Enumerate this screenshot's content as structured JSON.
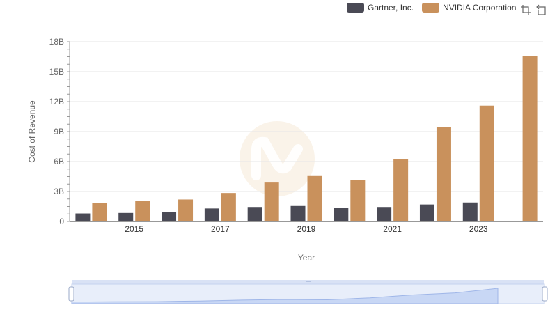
{
  "legend": {
    "items": [
      {
        "label": "Gartner, Inc.",
        "color": "#4a4a55"
      },
      {
        "label": "NVIDIA Corporation",
        "color": "#c9915c"
      }
    ]
  },
  "toolbox": {
    "icons": [
      "zoom-icon",
      "restore-icon"
    ]
  },
  "chart_data": {
    "type": "bar",
    "categories": [
      "2014",
      "2015",
      "2016",
      "2017",
      "2018",
      "2019",
      "2020",
      "2021",
      "2022",
      "2023",
      "2024"
    ],
    "x_tick_labels": [
      "2015",
      "2017",
      "2019",
      "2021",
      "2023"
    ],
    "series": [
      {
        "name": "Gartner, Inc.",
        "color": "#4a4a55",
        "values": [
          0.8,
          0.85,
          0.95,
          1.3,
          1.45,
          1.55,
          1.35,
          1.45,
          1.7,
          1.9,
          null
        ]
      },
      {
        "name": "NVIDIA Corporation",
        "color": "#c9915c",
        "values": [
          1.85,
          2.05,
          2.2,
          2.85,
          3.9,
          4.55,
          4.15,
          6.25,
          9.45,
          11.6,
          16.6
        ]
      }
    ],
    "xlabel": "Year",
    "ylabel": "Cost of Revenue",
    "ylim": [
      0,
      18
    ],
    "y_ticks": [
      {
        "value": 0,
        "label": "0"
      },
      {
        "value": 3,
        "label": "3B"
      },
      {
        "value": 6,
        "label": "6B"
      },
      {
        "value": 9,
        "label": "9B"
      },
      {
        "value": 12,
        "label": "12B"
      },
      {
        "value": 15,
        "label": "15B"
      },
      {
        "value": 18,
        "label": "18B"
      }
    ],
    "grid": true,
    "legend_position": "top-right",
    "datazoom": {
      "range": [
        0,
        100
      ],
      "preview_series": "NVIDIA Corporation"
    }
  }
}
